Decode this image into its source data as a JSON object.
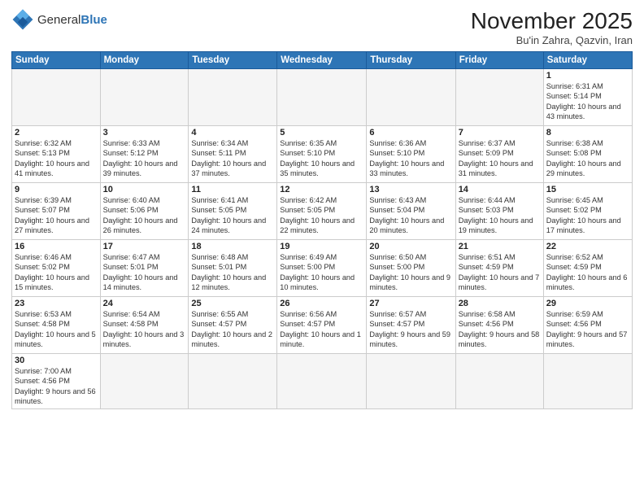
{
  "header": {
    "logo_general": "General",
    "logo_blue": "Blue",
    "month_year": "November 2025",
    "location": "Bu'in Zahra, Qazvin, Iran"
  },
  "weekdays": [
    "Sunday",
    "Monday",
    "Tuesday",
    "Wednesday",
    "Thursday",
    "Friday",
    "Saturday"
  ],
  "weeks": [
    [
      {
        "day": "",
        "info": ""
      },
      {
        "day": "",
        "info": ""
      },
      {
        "day": "",
        "info": ""
      },
      {
        "day": "",
        "info": ""
      },
      {
        "day": "",
        "info": ""
      },
      {
        "day": "",
        "info": ""
      },
      {
        "day": "1",
        "info": "Sunrise: 6:31 AM\nSunset: 5:14 PM\nDaylight: 10 hours and 43 minutes."
      }
    ],
    [
      {
        "day": "2",
        "info": "Sunrise: 6:32 AM\nSunset: 5:13 PM\nDaylight: 10 hours and 41 minutes."
      },
      {
        "day": "3",
        "info": "Sunrise: 6:33 AM\nSunset: 5:12 PM\nDaylight: 10 hours and 39 minutes."
      },
      {
        "day": "4",
        "info": "Sunrise: 6:34 AM\nSunset: 5:11 PM\nDaylight: 10 hours and 37 minutes."
      },
      {
        "day": "5",
        "info": "Sunrise: 6:35 AM\nSunset: 5:10 PM\nDaylight: 10 hours and 35 minutes."
      },
      {
        "day": "6",
        "info": "Sunrise: 6:36 AM\nSunset: 5:10 PM\nDaylight: 10 hours and 33 minutes."
      },
      {
        "day": "7",
        "info": "Sunrise: 6:37 AM\nSunset: 5:09 PM\nDaylight: 10 hours and 31 minutes."
      },
      {
        "day": "8",
        "info": "Sunrise: 6:38 AM\nSunset: 5:08 PM\nDaylight: 10 hours and 29 minutes."
      }
    ],
    [
      {
        "day": "9",
        "info": "Sunrise: 6:39 AM\nSunset: 5:07 PM\nDaylight: 10 hours and 27 minutes."
      },
      {
        "day": "10",
        "info": "Sunrise: 6:40 AM\nSunset: 5:06 PM\nDaylight: 10 hours and 26 minutes."
      },
      {
        "day": "11",
        "info": "Sunrise: 6:41 AM\nSunset: 5:05 PM\nDaylight: 10 hours and 24 minutes."
      },
      {
        "day": "12",
        "info": "Sunrise: 6:42 AM\nSunset: 5:05 PM\nDaylight: 10 hours and 22 minutes."
      },
      {
        "day": "13",
        "info": "Sunrise: 6:43 AM\nSunset: 5:04 PM\nDaylight: 10 hours and 20 minutes."
      },
      {
        "day": "14",
        "info": "Sunrise: 6:44 AM\nSunset: 5:03 PM\nDaylight: 10 hours and 19 minutes."
      },
      {
        "day": "15",
        "info": "Sunrise: 6:45 AM\nSunset: 5:02 PM\nDaylight: 10 hours and 17 minutes."
      }
    ],
    [
      {
        "day": "16",
        "info": "Sunrise: 6:46 AM\nSunset: 5:02 PM\nDaylight: 10 hours and 15 minutes."
      },
      {
        "day": "17",
        "info": "Sunrise: 6:47 AM\nSunset: 5:01 PM\nDaylight: 10 hours and 14 minutes."
      },
      {
        "day": "18",
        "info": "Sunrise: 6:48 AM\nSunset: 5:01 PM\nDaylight: 10 hours and 12 minutes."
      },
      {
        "day": "19",
        "info": "Sunrise: 6:49 AM\nSunset: 5:00 PM\nDaylight: 10 hours and 10 minutes."
      },
      {
        "day": "20",
        "info": "Sunrise: 6:50 AM\nSunset: 5:00 PM\nDaylight: 10 hours and 9 minutes."
      },
      {
        "day": "21",
        "info": "Sunrise: 6:51 AM\nSunset: 4:59 PM\nDaylight: 10 hours and 7 minutes."
      },
      {
        "day": "22",
        "info": "Sunrise: 6:52 AM\nSunset: 4:59 PM\nDaylight: 10 hours and 6 minutes."
      }
    ],
    [
      {
        "day": "23",
        "info": "Sunrise: 6:53 AM\nSunset: 4:58 PM\nDaylight: 10 hours and 5 minutes."
      },
      {
        "day": "24",
        "info": "Sunrise: 6:54 AM\nSunset: 4:58 PM\nDaylight: 10 hours and 3 minutes."
      },
      {
        "day": "25",
        "info": "Sunrise: 6:55 AM\nSunset: 4:57 PM\nDaylight: 10 hours and 2 minutes."
      },
      {
        "day": "26",
        "info": "Sunrise: 6:56 AM\nSunset: 4:57 PM\nDaylight: 10 hours and 1 minute."
      },
      {
        "day": "27",
        "info": "Sunrise: 6:57 AM\nSunset: 4:57 PM\nDaylight: 9 hours and 59 minutes."
      },
      {
        "day": "28",
        "info": "Sunrise: 6:58 AM\nSunset: 4:56 PM\nDaylight: 9 hours and 58 minutes."
      },
      {
        "day": "29",
        "info": "Sunrise: 6:59 AM\nSunset: 4:56 PM\nDaylight: 9 hours and 57 minutes."
      }
    ],
    [
      {
        "day": "30",
        "info": "Sunrise: 7:00 AM\nSunset: 4:56 PM\nDaylight: 9 hours and 56 minutes."
      },
      {
        "day": "",
        "info": ""
      },
      {
        "day": "",
        "info": ""
      },
      {
        "day": "",
        "info": ""
      },
      {
        "day": "",
        "info": ""
      },
      {
        "day": "",
        "info": ""
      },
      {
        "day": "",
        "info": ""
      }
    ]
  ]
}
